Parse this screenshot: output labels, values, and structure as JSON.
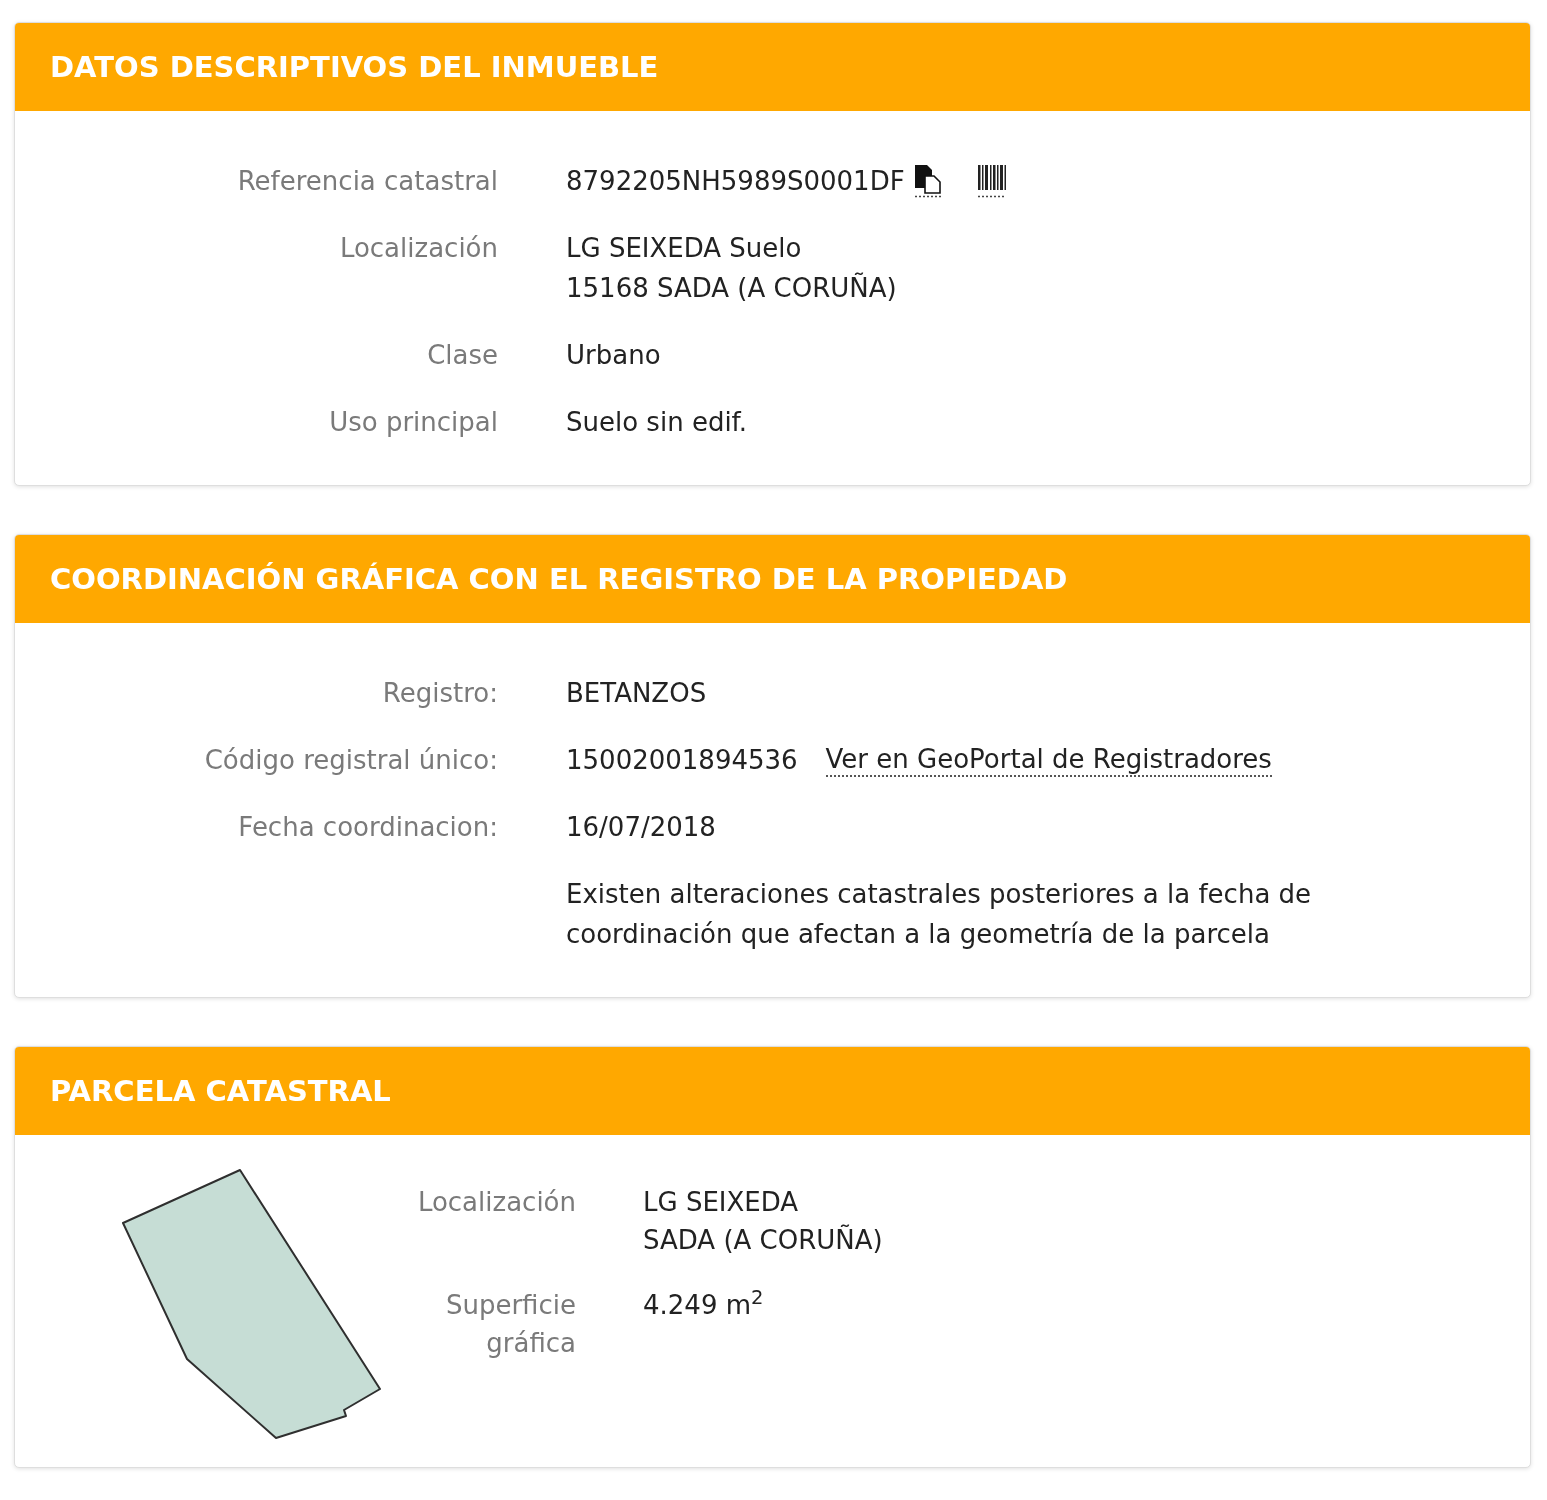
{
  "sections": [
    {
      "kind": "fields",
      "title": "DATOS DESCRIPTIVOS DEL INMUEBLE",
      "rows": [
        {
          "kind": "reference",
          "label": "Referencia catastral",
          "lines": [
            "8792205NH5989S0001DF"
          ]
        },
        {
          "kind": "text",
          "label": "Localización",
          "lines": [
            "LG SEIXEDA Suelo",
            "15168 SADA (A CORUÑA)"
          ]
        },
        {
          "kind": "text",
          "label": "Clase",
          "lines": [
            "Urbano"
          ]
        },
        {
          "kind": "text",
          "label": "Uso principal",
          "lines": [
            "Suelo sin edif."
          ]
        }
      ]
    },
    {
      "kind": "fields",
      "title": "COORDINACIÓN GRÁFICA CON EL REGISTRO DE LA PROPIEDAD",
      "rows": [
        {
          "kind": "text",
          "label": "Registro:",
          "lines": [
            "BETANZOS"
          ]
        },
        {
          "kind": "link",
          "label": "Código registral único:",
          "lines": [
            "15002001894536"
          ],
          "link": "Ver en GeoPortal de Registradores"
        },
        {
          "kind": "text",
          "label": "Fecha coordinacion:",
          "lines": [
            "16/07/2018"
          ]
        },
        {
          "kind": "note",
          "lines": [
            "Existen alteraciones catastrales posteriores a la fecha de coordinación que afectan a la geometría de la parcela"
          ]
        }
      ]
    },
    {
      "kind": "parcel",
      "title": "PARCELA CATASTRAL",
      "rows": [
        {
          "kind": "text",
          "label": "Localización",
          "lines": [
            "LG SEIXEDA",
            "SADA (A CORUÑA)"
          ]
        },
        {
          "kind": "text",
          "label": "Superficie gráfica",
          "lines": [
            "4.249 m$^{2}$"
          ]
        }
      ]
    }
  ]
}
